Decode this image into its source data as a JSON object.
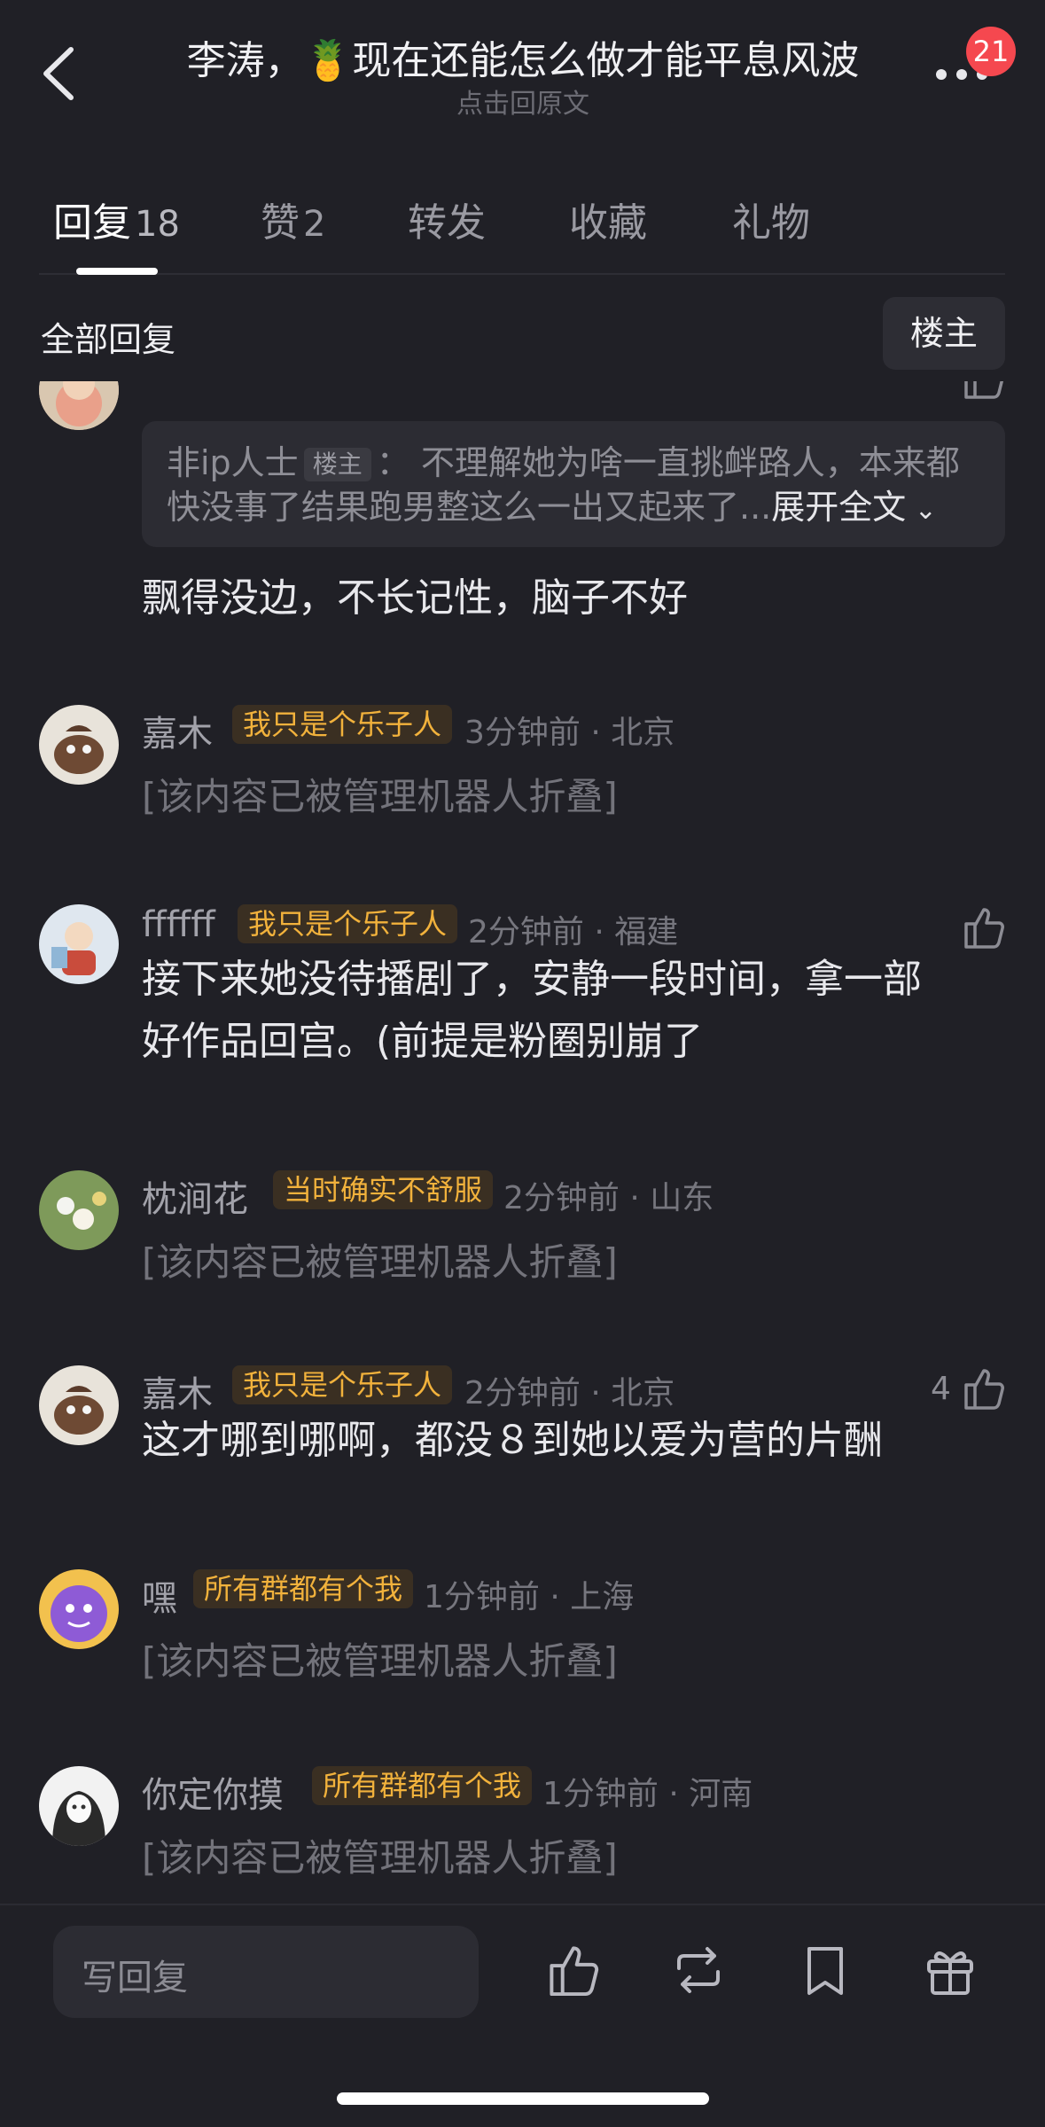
{
  "header": {
    "title": "李涛，🍍现在还能怎么做才能平息风波",
    "subtitle": "点击回原文",
    "notification_count": "21"
  },
  "tabs": [
    {
      "label": "回复",
      "count": "18",
      "active": true
    },
    {
      "label": "赞",
      "count": "2",
      "active": false
    },
    {
      "label": "转发",
      "count": "",
      "active": false
    },
    {
      "label": "收藏",
      "count": "",
      "active": false
    },
    {
      "label": "礼物",
      "count": "",
      "active": false
    }
  ],
  "filter": {
    "all_replies_label": "全部回复",
    "op_only_label": "楼主"
  },
  "comments": [
    {
      "quote": {
        "author": "非ip人士",
        "author_tag": "楼主",
        "separator": "：",
        "text": "不理解她为啥一直挑衅路人，本来都快没事了结果跑男整这么一出又起来了...",
        "expand_label": "展开全文"
      },
      "content": "飘得没边，不长记性，脑子不好"
    },
    {
      "username": "嘉木",
      "tag": "我只是个乐子人",
      "meta": "3分钟前 · 北京",
      "content": "[该内容已被管理机器人折叠]"
    },
    {
      "username": "ffffff",
      "tag": "我只是个乐子人",
      "meta": "2分钟前 · 福建",
      "content_line1": "接下来她没待播剧了，安静一段时间，拿一部",
      "content_line2": "好作品回宫。(前提是粉圈别崩了"
    },
    {
      "username": "枕涧花",
      "tag": "当时确实不舒服",
      "meta": "2分钟前 · 山东",
      "content": "[该内容已被管理机器人折叠]"
    },
    {
      "username": "嘉木",
      "tag": "我只是个乐子人",
      "meta": "2分钟前 · 北京",
      "like_count": "4",
      "content": "这才哪到哪啊，都没８到她以爱为营的片酬"
    },
    {
      "username": "嘿",
      "tag": "所有群都有个我",
      "meta": "1分钟前 · 上海",
      "content": "[该内容已被管理机器人折叠]"
    },
    {
      "username": "你定你摸",
      "tag": "所有群都有个我",
      "meta": "1分钟前 · 河南",
      "content": "[该内容已被管理机器人折叠]"
    }
  ],
  "bottom_bar": {
    "reply_placeholder": "写回复"
  },
  "colors": {
    "background": "#202026",
    "tag_text": "#f2b23c",
    "badge": "#f5484f"
  }
}
